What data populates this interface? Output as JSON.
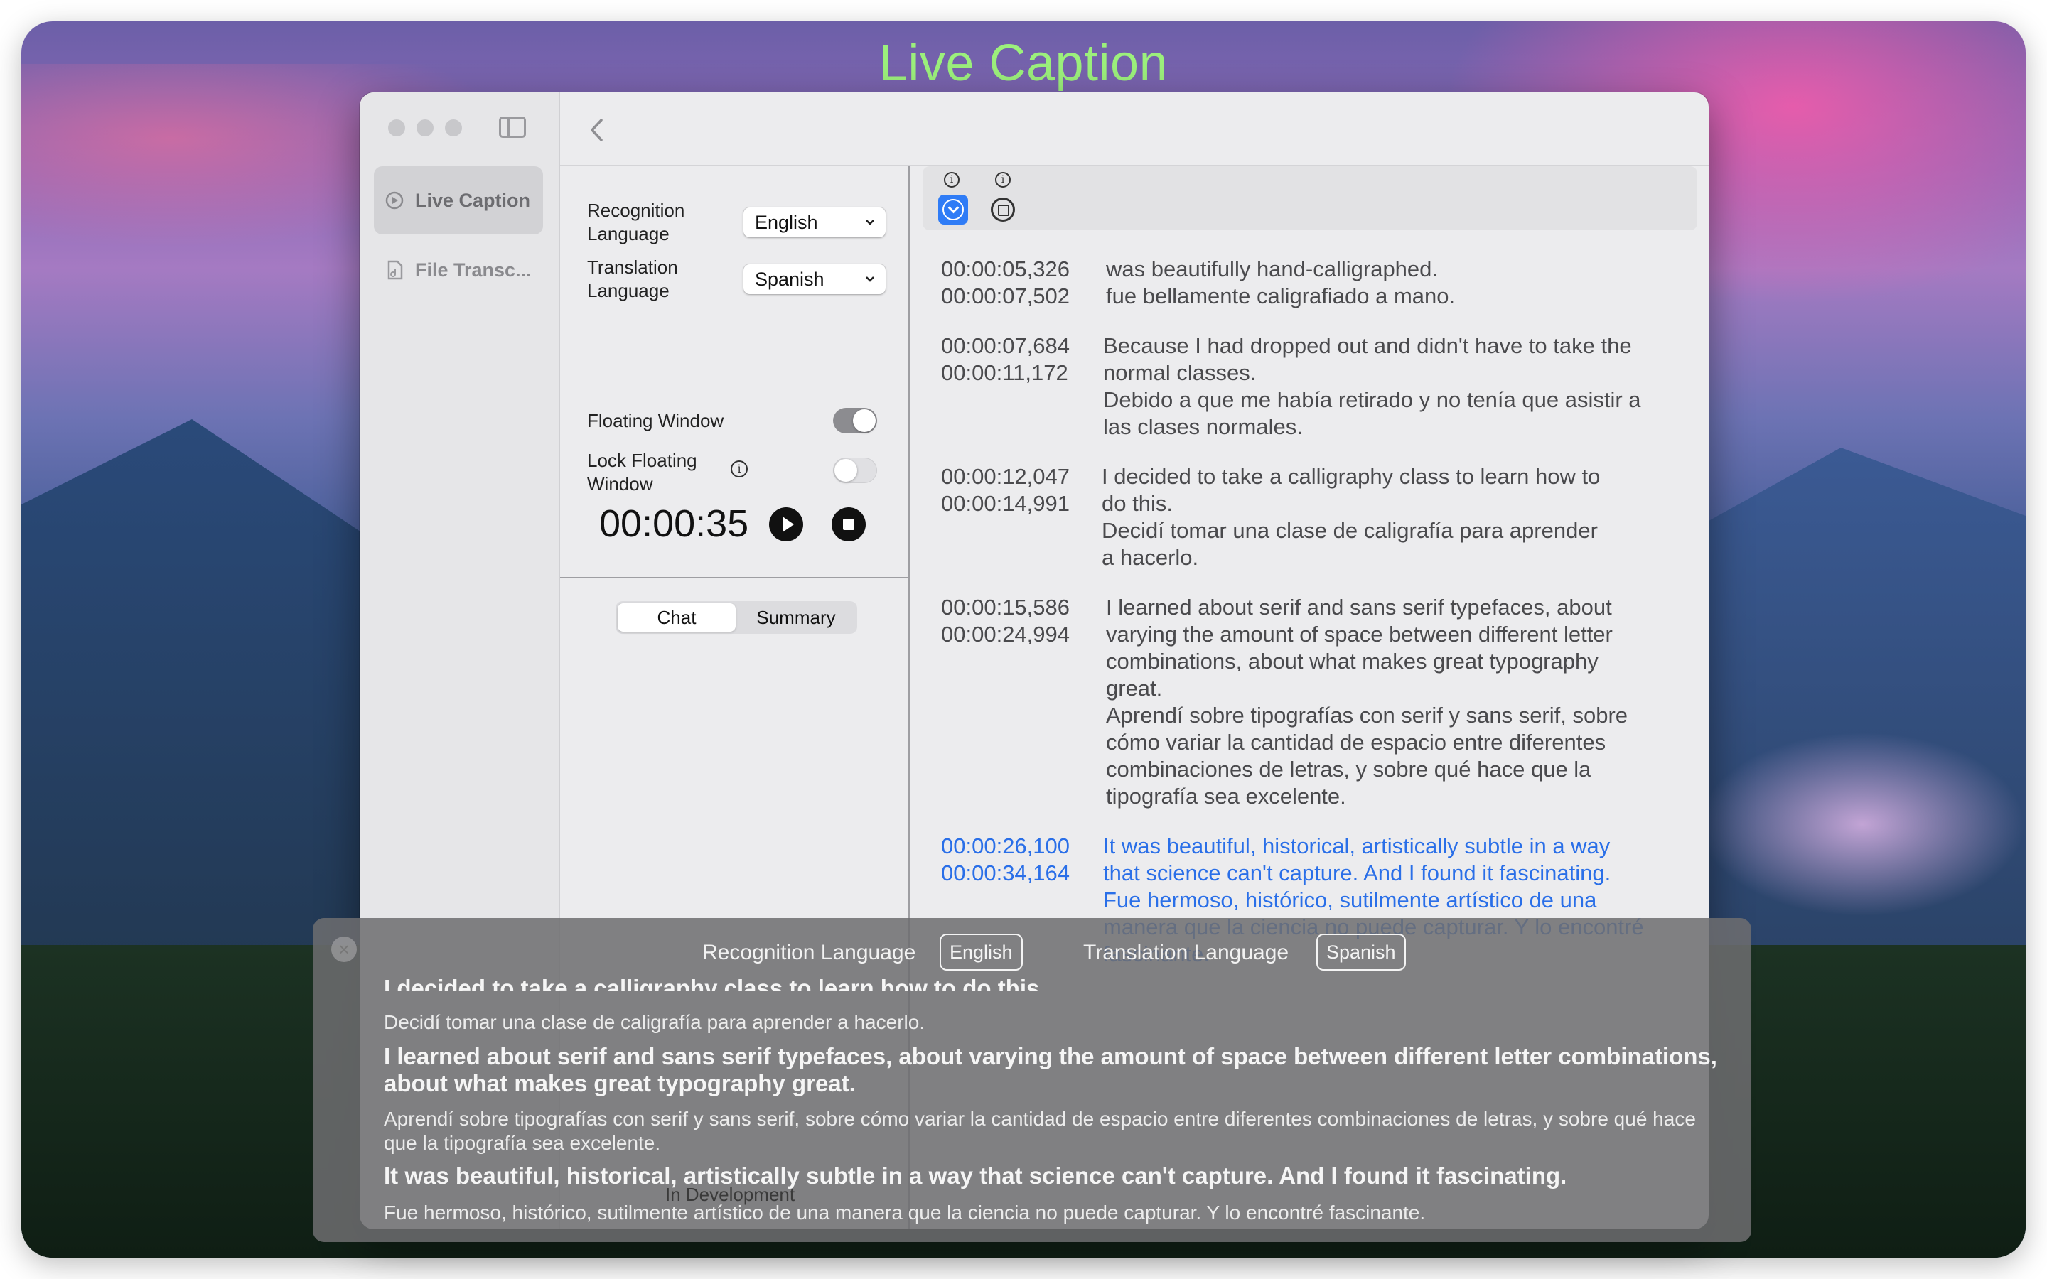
{
  "app_title": "Live Caption",
  "sidebar": {
    "items": [
      {
        "label": "Live Caption",
        "icon": "play-circle-icon",
        "active": true
      },
      {
        "label": "File Transc...",
        "icon": "music-file-icon",
        "active": false
      }
    ]
  },
  "controls": {
    "recognition_label": "Recognition\nLanguage",
    "recognition_value": "English",
    "translation_label": "Translation\nLanguage",
    "translation_value": "Spanish",
    "floating_window_label": "Floating Window",
    "floating_window_on": true,
    "lock_floating_label": "Lock Floating\nWindow",
    "lock_floating_on": false,
    "timer": "00:00:35"
  },
  "tabs": {
    "chat": "Chat",
    "summary": "Summary",
    "selected": "Chat"
  },
  "transcript": {
    "segments": [
      {
        "start": "00:00:05,326",
        "end": "00:00:07,502",
        "text": "was beautifully hand-calligraphed.\nfue bellamente caligrafiado a mano."
      },
      {
        "start": "00:00:07,684",
        "end": "00:00:11,172",
        "text": "Because I had dropped out and didn't have to take the\nnormal classes.\nDebido a que me había retirado y no tenía que asistir a\nlas clases normales."
      },
      {
        "start": "00:00:12,047",
        "end": "00:00:14,991",
        "text": "I decided to take a calligraphy class to learn how to\ndo this.\nDecidí tomar una clase de caligrafía para aprender\na hacerlo."
      },
      {
        "start": "00:00:15,586",
        "end": "00:00:24,994",
        "text": "I learned about serif and sans serif typefaces, about\nvarying the amount of space between different letter\ncombinations, about what makes great typography\ngreat.\nAprendí sobre tipografías con serif y sans serif, sobre\ncómo variar la cantidad de espacio entre diferentes\ncombinaciones de letras, y sobre qué hace que la\ntipografía sea excelente."
      },
      {
        "start": "00:00:26,100",
        "end": "00:00:34,164",
        "text": "It was beautiful, historical, artistically subtle in a way\nthat science can't capture. And I found it fascinating.\nFue hermoso, histórico, sutilmente artístico de una\nmanera que la ciencia no puede capturar. Y lo encontré\nfascinante."
      }
    ]
  },
  "floating": {
    "recognition_label": "Recognition Language",
    "recognition_value": "English",
    "translation_label": "Translation Language",
    "translation_value": "Spanish",
    "lines": [
      {
        "lang": "en",
        "text": "I decided to take a calligraphy class to learn how to do this."
      },
      {
        "lang": "es",
        "text": "Decidí tomar una clase de caligrafía para aprender a hacerlo."
      },
      {
        "lang": "en",
        "text": "I learned about serif and sans serif typefaces, about varying the amount of space between different letter combinations, about what makes great typography great."
      },
      {
        "lang": "es",
        "text": "Aprendí sobre tipografías con serif y sans serif, sobre cómo variar la cantidad de espacio entre diferentes combinaciones de letras, y sobre qué hace que la tipografía sea excelente."
      },
      {
        "lang": "en",
        "text": "It was beautiful, historical, artistically subtle in a way that science can't capture. And I found it fascinating."
      },
      {
        "lang": "es",
        "text": "Fue hermoso, histórico, sutilmente artístico de una manera que la ciencia no puede capturar. Y lo encontré fascinante."
      }
    ],
    "dev_note": "In Development"
  },
  "colors": {
    "title_green": "#9cf07c",
    "accent_blue": "#2f7cf6",
    "current_caption_blue": "#2a6fe8"
  }
}
